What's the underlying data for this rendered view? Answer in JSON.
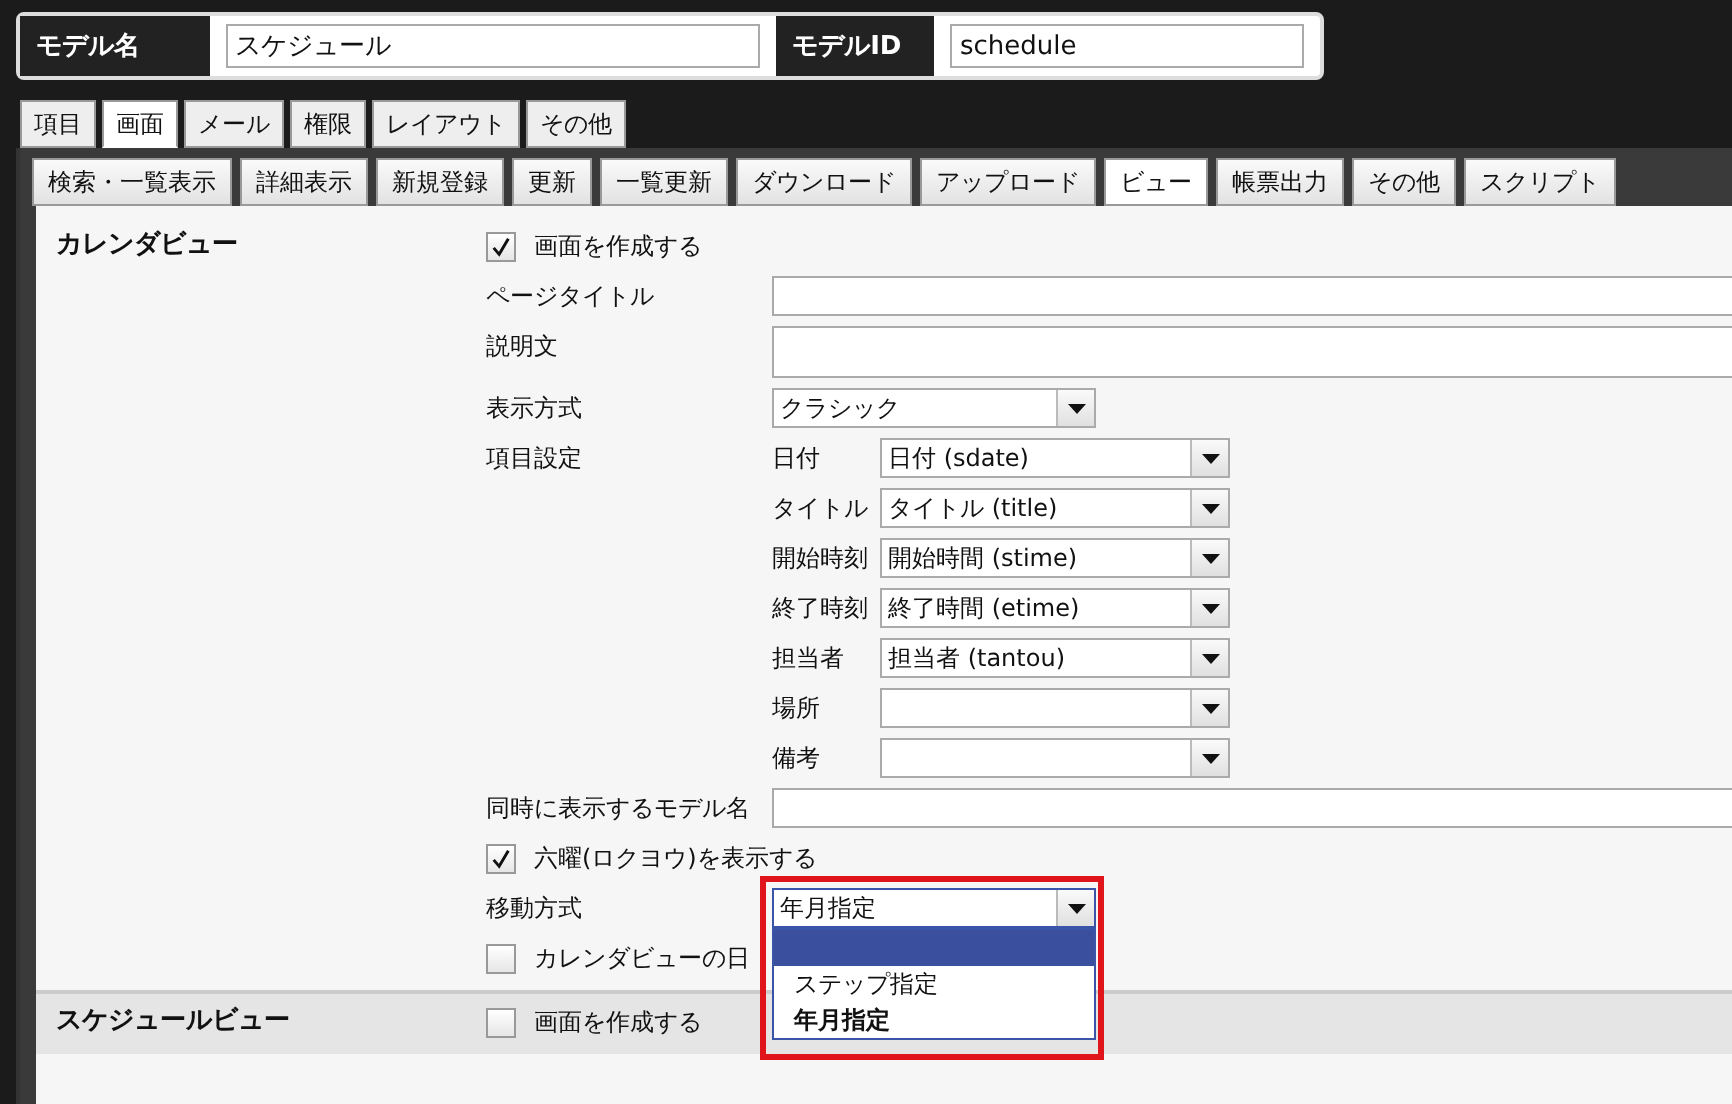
{
  "model_header": [
    {
      "label": "モデル名",
      "value": "スケジュール"
    },
    {
      "label": "モデルID",
      "value": "schedule"
    }
  ],
  "top_tabs": [
    {
      "label": "項目",
      "selected": false
    },
    {
      "label": "画面",
      "selected": true
    },
    {
      "label": "メール",
      "selected": false
    },
    {
      "label": "権限",
      "selected": false
    },
    {
      "label": "レイアウト",
      "selected": false
    },
    {
      "label": "その他",
      "selected": false
    }
  ],
  "sub_tabs": [
    {
      "label": "検索・一覧表示",
      "selected": false
    },
    {
      "label": "詳細表示",
      "selected": false
    },
    {
      "label": "新規登録",
      "selected": false
    },
    {
      "label": "更新",
      "selected": false
    },
    {
      "label": "一覧更新",
      "selected": false
    },
    {
      "label": "ダウンロード",
      "selected": false
    },
    {
      "label": "アップロード",
      "selected": false
    },
    {
      "label": "ビュー",
      "selected": true
    },
    {
      "label": "帳票出力",
      "selected": false
    },
    {
      "label": "その他",
      "selected": false
    },
    {
      "label": "スクリプト",
      "selected": false
    }
  ],
  "sections": [
    {
      "title": "カレンダビュー",
      "rows": [
        {
          "kind": "checkbox",
          "label": "画面を作成する",
          "checked": true
        },
        {
          "kind": "text",
          "label": "ページタイトル"
        },
        {
          "kind": "textarea",
          "label": "説明文"
        },
        {
          "kind": "select",
          "label": "表示方式",
          "value": "クラシック"
        },
        {
          "kind": "mapping",
          "label": "項目設定",
          "items": [
            {
              "label": "日付",
              "value": "日付 (sdate)"
            },
            {
              "label": "タイトル",
              "value": "タイトル (title)"
            },
            {
              "label": "開始時刻",
              "value": "開始時間 (stime)"
            },
            {
              "label": "終了時刻",
              "value": "終了時間 (etime)"
            },
            {
              "label": "担当者",
              "value": "担当者 (tantou)"
            },
            {
              "label": "場所"
            },
            {
              "label": "備考"
            }
          ]
        },
        {
          "kind": "text",
          "label": "同時に表示するモデル名"
        },
        {
          "kind": "checkbox",
          "label": "六曜(ロクヨウ)を表示する",
          "checked": true
        },
        {
          "kind": "select",
          "label": "移動方式",
          "value": "年月指定",
          "expanded": true,
          "options": [
            {
              "highlighted": true,
              "selected": false
            },
            {
              "label": "ステップ指定",
              "highlighted": false,
              "selected": false
            },
            {
              "label": "年月指定",
              "highlighted": false,
              "selected": true
            }
          ]
        },
        {
          "kind": "checkbox",
          "label": "カレンダビューの日",
          "checked": false
        }
      ]
    },
    {
      "title": "スケジュールビュー",
      "rows": [
        {
          "kind": "checkbox",
          "label": "画面を作成する",
          "checked": false
        }
      ]
    }
  ]
}
